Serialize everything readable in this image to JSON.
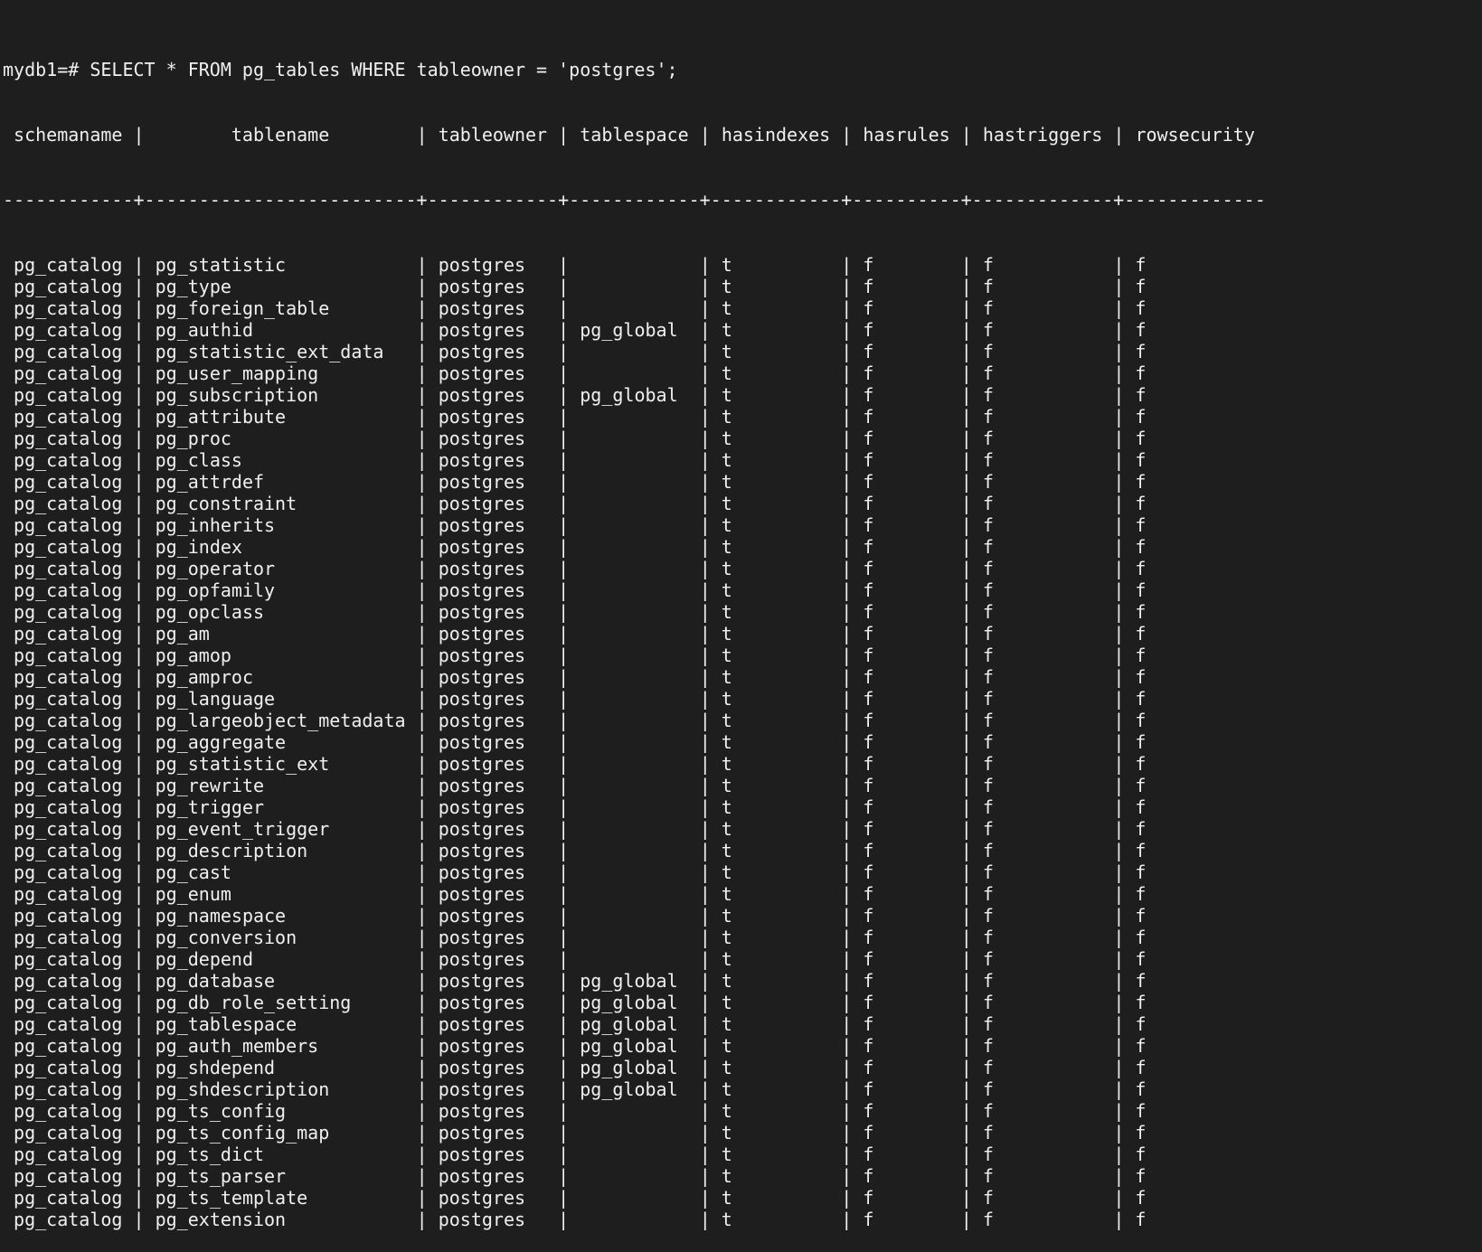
{
  "prompt": "mydb1=#",
  "command": "SELECT * FROM pg_tables WHERE tableowner = 'postgres';",
  "table": {
    "columns": [
      "schemaname",
      "tablename",
      "tableowner",
      "tablespace",
      "hasindexes",
      "hasrules",
      "hastriggers",
      "rowsecurity"
    ],
    "rows": [
      [
        "pg_catalog",
        "pg_statistic",
        "postgres",
        "",
        "t",
        "f",
        "f",
        "f"
      ],
      [
        "pg_catalog",
        "pg_type",
        "postgres",
        "",
        "t",
        "f",
        "f",
        "f"
      ],
      [
        "pg_catalog",
        "pg_foreign_table",
        "postgres",
        "",
        "t",
        "f",
        "f",
        "f"
      ],
      [
        "pg_catalog",
        "pg_authid",
        "postgres",
        "pg_global",
        "t",
        "f",
        "f",
        "f"
      ],
      [
        "pg_catalog",
        "pg_statistic_ext_data",
        "postgres",
        "",
        "t",
        "f",
        "f",
        "f"
      ],
      [
        "pg_catalog",
        "pg_user_mapping",
        "postgres",
        "",
        "t",
        "f",
        "f",
        "f"
      ],
      [
        "pg_catalog",
        "pg_subscription",
        "postgres",
        "pg_global",
        "t",
        "f",
        "f",
        "f"
      ],
      [
        "pg_catalog",
        "pg_attribute",
        "postgres",
        "",
        "t",
        "f",
        "f",
        "f"
      ],
      [
        "pg_catalog",
        "pg_proc",
        "postgres",
        "",
        "t",
        "f",
        "f",
        "f"
      ],
      [
        "pg_catalog",
        "pg_class",
        "postgres",
        "",
        "t",
        "f",
        "f",
        "f"
      ],
      [
        "pg_catalog",
        "pg_attrdef",
        "postgres",
        "",
        "t",
        "f",
        "f",
        "f"
      ],
      [
        "pg_catalog",
        "pg_constraint",
        "postgres",
        "",
        "t",
        "f",
        "f",
        "f"
      ],
      [
        "pg_catalog",
        "pg_inherits",
        "postgres",
        "",
        "t",
        "f",
        "f",
        "f"
      ],
      [
        "pg_catalog",
        "pg_index",
        "postgres",
        "",
        "t",
        "f",
        "f",
        "f"
      ],
      [
        "pg_catalog",
        "pg_operator",
        "postgres",
        "",
        "t",
        "f",
        "f",
        "f"
      ],
      [
        "pg_catalog",
        "pg_opfamily",
        "postgres",
        "",
        "t",
        "f",
        "f",
        "f"
      ],
      [
        "pg_catalog",
        "pg_opclass",
        "postgres",
        "",
        "t",
        "f",
        "f",
        "f"
      ],
      [
        "pg_catalog",
        "pg_am",
        "postgres",
        "",
        "t",
        "f",
        "f",
        "f"
      ],
      [
        "pg_catalog",
        "pg_amop",
        "postgres",
        "",
        "t",
        "f",
        "f",
        "f"
      ],
      [
        "pg_catalog",
        "pg_amproc",
        "postgres",
        "",
        "t",
        "f",
        "f",
        "f"
      ],
      [
        "pg_catalog",
        "pg_language",
        "postgres",
        "",
        "t",
        "f",
        "f",
        "f"
      ],
      [
        "pg_catalog",
        "pg_largeobject_metadata",
        "postgres",
        "",
        "t",
        "f",
        "f",
        "f"
      ],
      [
        "pg_catalog",
        "pg_aggregate",
        "postgres",
        "",
        "t",
        "f",
        "f",
        "f"
      ],
      [
        "pg_catalog",
        "pg_statistic_ext",
        "postgres",
        "",
        "t",
        "f",
        "f",
        "f"
      ],
      [
        "pg_catalog",
        "pg_rewrite",
        "postgres",
        "",
        "t",
        "f",
        "f",
        "f"
      ],
      [
        "pg_catalog",
        "pg_trigger",
        "postgres",
        "",
        "t",
        "f",
        "f",
        "f"
      ],
      [
        "pg_catalog",
        "pg_event_trigger",
        "postgres",
        "",
        "t",
        "f",
        "f",
        "f"
      ],
      [
        "pg_catalog",
        "pg_description",
        "postgres",
        "",
        "t",
        "f",
        "f",
        "f"
      ],
      [
        "pg_catalog",
        "pg_cast",
        "postgres",
        "",
        "t",
        "f",
        "f",
        "f"
      ],
      [
        "pg_catalog",
        "pg_enum",
        "postgres",
        "",
        "t",
        "f",
        "f",
        "f"
      ],
      [
        "pg_catalog",
        "pg_namespace",
        "postgres",
        "",
        "t",
        "f",
        "f",
        "f"
      ],
      [
        "pg_catalog",
        "pg_conversion",
        "postgres",
        "",
        "t",
        "f",
        "f",
        "f"
      ],
      [
        "pg_catalog",
        "pg_depend",
        "postgres",
        "",
        "t",
        "f",
        "f",
        "f"
      ],
      [
        "pg_catalog",
        "pg_database",
        "postgres",
        "pg_global",
        "t",
        "f",
        "f",
        "f"
      ],
      [
        "pg_catalog",
        "pg_db_role_setting",
        "postgres",
        "pg_global",
        "t",
        "f",
        "f",
        "f"
      ],
      [
        "pg_catalog",
        "pg_tablespace",
        "postgres",
        "pg_global",
        "t",
        "f",
        "f",
        "f"
      ],
      [
        "pg_catalog",
        "pg_auth_members",
        "postgres",
        "pg_global",
        "t",
        "f",
        "f",
        "f"
      ],
      [
        "pg_catalog",
        "pg_shdepend",
        "postgres",
        "pg_global",
        "t",
        "f",
        "f",
        "f"
      ],
      [
        "pg_catalog",
        "pg_shdescription",
        "postgres",
        "pg_global",
        "t",
        "f",
        "f",
        "f"
      ],
      [
        "pg_catalog",
        "pg_ts_config",
        "postgres",
        "",
        "t",
        "f",
        "f",
        "f"
      ],
      [
        "pg_catalog",
        "pg_ts_config_map",
        "postgres",
        "",
        "t",
        "f",
        "f",
        "f"
      ],
      [
        "pg_catalog",
        "pg_ts_dict",
        "postgres",
        "",
        "t",
        "f",
        "f",
        "f"
      ],
      [
        "pg_catalog",
        "pg_ts_parser",
        "postgres",
        "",
        "t",
        "f",
        "f",
        "f"
      ],
      [
        "pg_catalog",
        "pg_ts_template",
        "postgres",
        "",
        "t",
        "f",
        "f",
        "f"
      ],
      [
        "pg_catalog",
        "pg_extension",
        "postgres",
        "",
        "t",
        "f",
        "f",
        "f"
      ]
    ]
  },
  "colors": {
    "background": "#1e1e1e",
    "foreground": "#f0f0f0"
  }
}
